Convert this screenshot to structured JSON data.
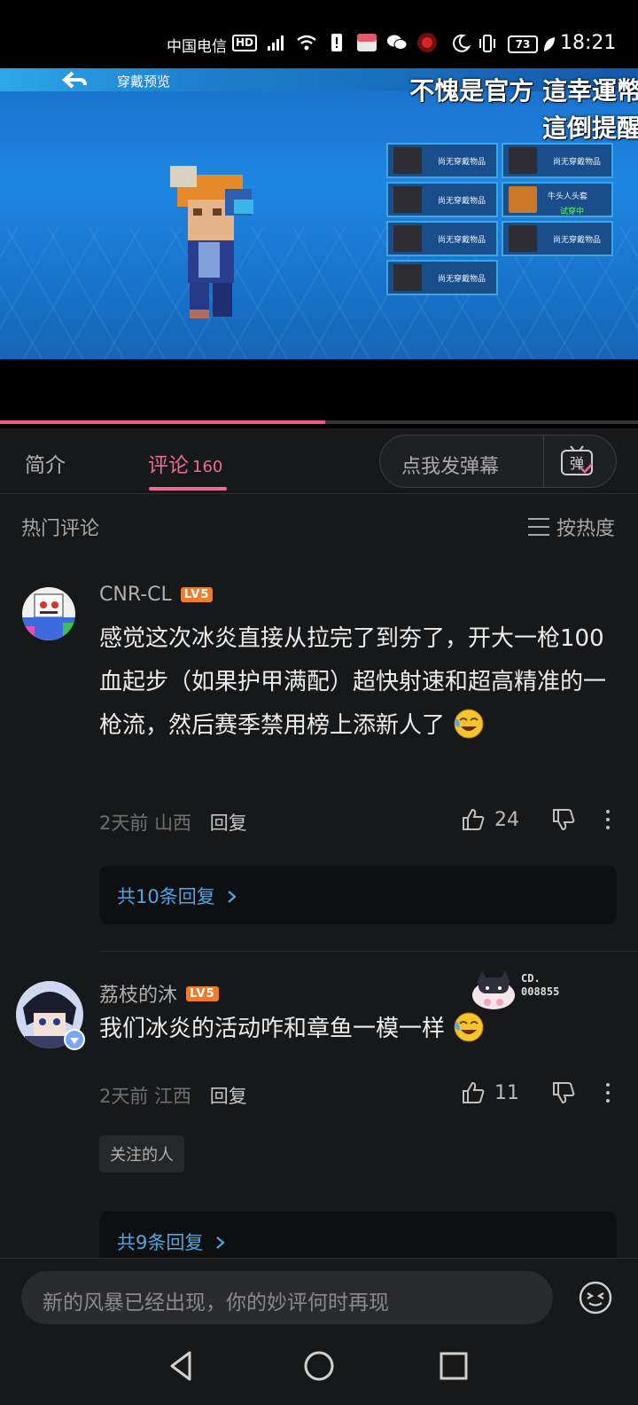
{
  "status_bar": {
    "carrier": "中国电信",
    "hd": "HD",
    "battery": "73",
    "time": "18:21"
  },
  "video": {
    "game_title": "穿戴预览",
    "subtitle_line1": "不愧是官方 這幸運幣",
    "subtitle_line2": "這倒提醒",
    "slots": [
      {
        "label": "尚无穿戴物品"
      },
      {
        "label": "尚无穿戴物品"
      },
      {
        "label": "尚无穿戴物品"
      },
      {
        "label": "牛头人头套",
        "status": "试穿中"
      },
      {
        "label": "尚无穿戴物品"
      },
      {
        "label": "尚无穿戴物品"
      },
      {
        "label": "尚无穿戴物品"
      }
    ],
    "progress": 0.51
  },
  "tabs": {
    "intro": "简介",
    "comments": "评论",
    "comments_count": "160",
    "danmaku_placeholder": "点我发弹幕",
    "danmaku_icon_char": "弹"
  },
  "section": {
    "title": "热门评论",
    "sort": "按热度"
  },
  "comments": [
    {
      "username": "CNR-CL",
      "level": "LV5",
      "text": "感觉这次冰炎直接从拉完了到夯了，开大一枪100血起步（如果护甲满配）超快射速和超高精准的一枪流，然后赛季禁用榜上添新人了",
      "time": "2天前",
      "location": "山西",
      "reply": "回复",
      "likes": "24",
      "replies": "共10条回复"
    },
    {
      "username": "荔枝的沐",
      "level": "LV5",
      "badge_text": "CD.\n008855",
      "text": "我们冰炎的活动咋和章鱼一模一样",
      "time": "2天前",
      "location": "江西",
      "reply": "回复",
      "likes": "11",
      "tag": "关注的人",
      "replies": "共9条回复"
    }
  ],
  "input": {
    "placeholder": "新的风暴已经出现，你的妙评何时再现"
  },
  "colors": {
    "accent": "#f06a95",
    "link": "#4fa6e0",
    "level": "#ee7d2b"
  }
}
